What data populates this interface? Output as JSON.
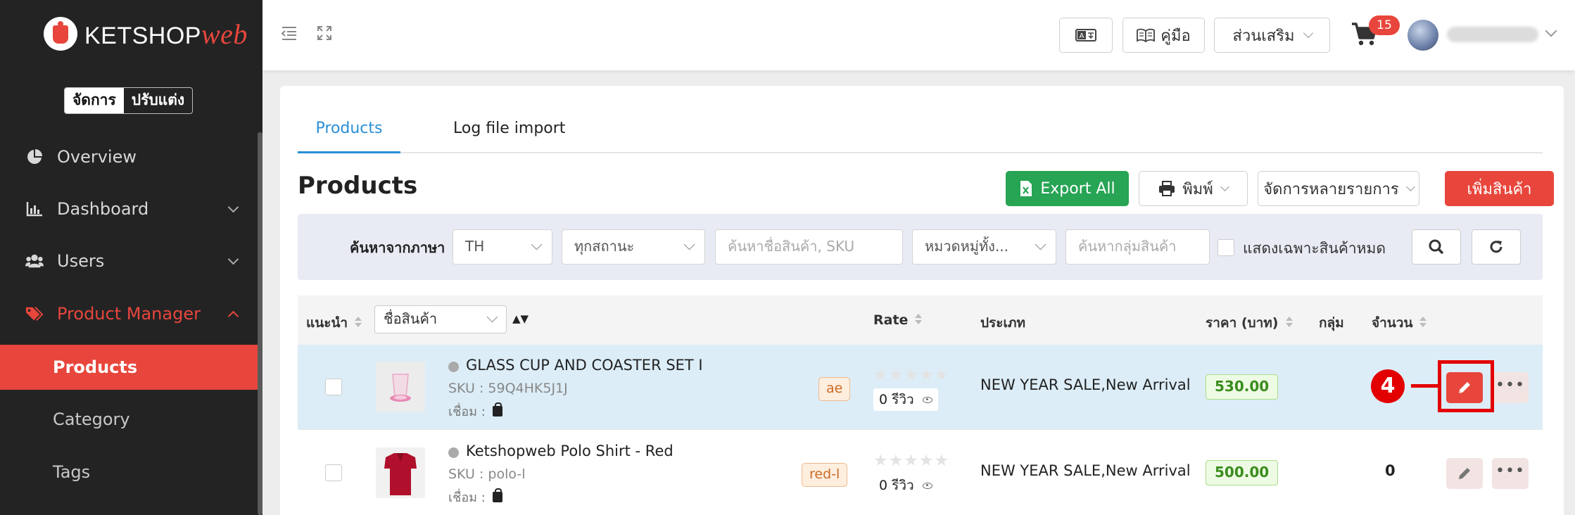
{
  "sidebar": {
    "logo_text": "KETSHOP",
    "logo_text_accent": "web",
    "mode_switch": [
      "จัดการ",
      "ปรับแต่ง"
    ],
    "items": [
      {
        "label": "Overview",
        "icon": "pie-chart-icon"
      },
      {
        "label": "Dashboard",
        "icon": "bar-chart-icon"
      },
      {
        "label": "Users",
        "icon": "users-icon"
      },
      {
        "label": "Product Manager",
        "icon": "tag-icon"
      }
    ],
    "sub_items": [
      {
        "label": "Products"
      },
      {
        "label": "Category"
      },
      {
        "label": "Tags"
      }
    ]
  },
  "topbar": {
    "manual_label": "คู่มือ",
    "addons_label": "ส่วนเสริม",
    "cart_count": "15"
  },
  "tabs": [
    {
      "label": "Products"
    },
    {
      "label": "Log file import"
    }
  ],
  "page": {
    "title": "Products",
    "export_label": "Export All",
    "print_label": "พิมพ์",
    "bulk_label": "จัดการหลายรายการ",
    "add_label": "เพิ่มสินค้า"
  },
  "filters": {
    "lang_label": "ค้นหาจากภาษา",
    "lang_value": "TH",
    "status_value": "ทุกสถานะ",
    "search_placeholder": "ค้นหาชื่อสินค้า, SKU",
    "category_value": "หมวดหมู่ทั้ง...",
    "group_placeholder": "ค้นหากลุ่มสินค้า",
    "out_of_stock_label": "แสดงเฉพาะสินค้าหมด"
  },
  "table": {
    "headers": {
      "featured": "แนะนำ",
      "name_select": "ชื่อสินค้า",
      "rate": "Rate",
      "type": "ประเภท",
      "price": "ราคา (บาท)",
      "group": "กลุ่ม",
      "qty": "จำนวน"
    },
    "rows": [
      {
        "name": "GLASS CUP AND COASTER SET I",
        "sku": "SKU : 59Q4HK5J1J",
        "link": "เชื่อม :",
        "tag": "ae",
        "stars": "★★★★★",
        "reviews": "0 รีวิว",
        "type": "NEW YEAR SALE,New Arrival",
        "price": "530.00",
        "qty": ""
      },
      {
        "name": "Ketshopweb Polo Shirt - Red",
        "sku": "SKU : polo-l",
        "link": "เชื่อม :",
        "tag": "red-l",
        "stars": "★★★★★",
        "reviews": "0 รีวิว",
        "type": "NEW YEAR SALE,New Arrival",
        "price": "500.00",
        "qty": "0"
      }
    ]
  },
  "callout": {
    "number": "4"
  },
  "colors": {
    "accent": "#e8463c",
    "tab_active": "#2a8fd6",
    "export": "#27a454"
  }
}
